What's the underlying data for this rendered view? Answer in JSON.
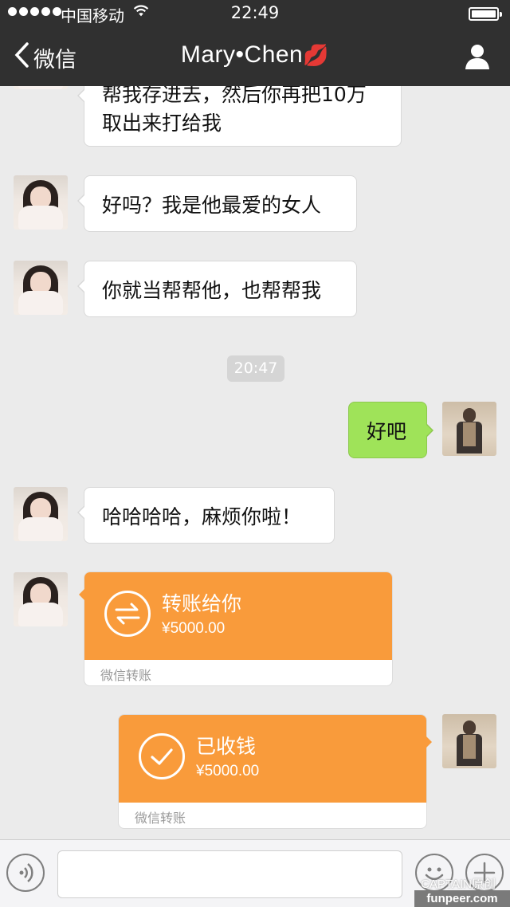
{
  "status_bar": {
    "carrier": "中国移动",
    "time": "22:49"
  },
  "nav": {
    "back_label": "微信",
    "title": "Mary•Chen",
    "title_emoji": "💋"
  },
  "messages": [
    {
      "side": "left",
      "lines": [
        "帮我存进去，然后你再把10万",
        "取出来打给我"
      ]
    },
    {
      "side": "left",
      "text": "好吗？我是他最爱的女人"
    },
    {
      "side": "left",
      "text": "你就当帮帮他，也帮帮我"
    },
    {
      "side": "right",
      "text": "好吧"
    },
    {
      "side": "left",
      "text": "哈哈哈哈，麻烦你啦！"
    }
  ],
  "timestamp": "20:47",
  "transfers": [
    {
      "side": "left",
      "title": "转账给你",
      "amount": "¥5000.00",
      "footer": "微信转账",
      "icon": "transfer-arrows-icon"
    },
    {
      "side": "right",
      "title": "已收钱",
      "amount": "¥5000.00",
      "footer": "微信转账",
      "icon": "checkmark-icon"
    }
  ],
  "input_bar": {
    "value": ""
  },
  "watermark": {
    "line1": "CAPTAIN原创",
    "line2": "funpeer.com"
  },
  "colors": {
    "nav": "#303030",
    "transfer": "#f99b3b",
    "green_bubble": "#9fe359",
    "chat_bg": "#ebebeb"
  }
}
